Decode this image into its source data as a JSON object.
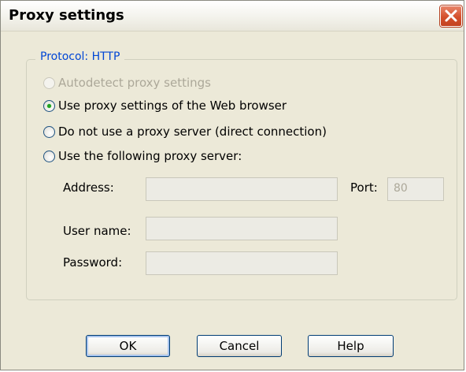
{
  "window": {
    "title": "Proxy settings"
  },
  "group": {
    "legend": "Protocol: HTTP"
  },
  "radio_options": [
    {
      "label": "Autodetect proxy settings",
      "checked": false,
      "disabled": true
    },
    {
      "label": "Use proxy settings of the Web browser",
      "checked": true,
      "disabled": false
    },
    {
      "label": "Do not use a proxy server (direct connection)",
      "checked": false,
      "disabled": false
    },
    {
      "label": "Use the following proxy server:",
      "checked": false,
      "disabled": false
    }
  ],
  "fields": {
    "address_label": "Address:",
    "address_value": "",
    "port_label": "Port:",
    "port_value": "80",
    "username_label": "User name:",
    "username_value": "",
    "password_label": "Password:",
    "password_value": ""
  },
  "buttons": {
    "ok": "OK",
    "cancel": "Cancel",
    "help": "Help"
  },
  "colors": {
    "accent": "#0046d5",
    "close_button": "#d4502c",
    "radio_checked": "#21a121",
    "disabled_text": "#aca899"
  }
}
